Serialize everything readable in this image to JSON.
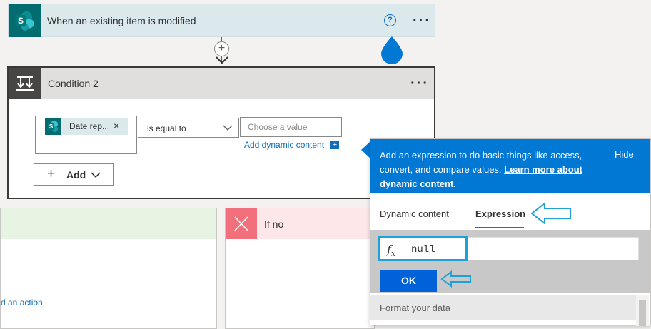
{
  "trigger": {
    "title": "When an existing item is modified",
    "help_label": "?",
    "more_label": "···"
  },
  "connector": {
    "plus_label": "+"
  },
  "condition": {
    "title": "Condition 2",
    "more_label": "···",
    "token_label": "Date rep...",
    "token_remove": "×",
    "operator": "is equal to",
    "value_placeholder": "Choose a value",
    "add_dynamic_label": "Add dynamic content",
    "add_dynamic_plus": "+",
    "add_button": {
      "plus": "+",
      "label": "Add"
    }
  },
  "branches": {
    "yes_add_action": "d an action",
    "no_label": "If no"
  },
  "popup": {
    "info_text": "Add an expression to do basic things like access, convert, and compare values.",
    "learn_more": "Learn more about dynamic content.",
    "hide_label": "Hide",
    "tabs": [
      {
        "label": "Dynamic content",
        "active": false
      },
      {
        "label": "Expression",
        "active": true
      }
    ],
    "expression_value": "null",
    "ok_label": "OK",
    "format_label": "Format your data"
  },
  "colors": {
    "accent": "#0078d4",
    "sharepoint": "#036c70",
    "annotation": "#1ea0d8"
  },
  "icons": [
    "sharepoint-icon",
    "help-icon",
    "more-icon",
    "add-step-icon",
    "condition-icon",
    "chevron-down-icon",
    "close-icon",
    "fx-icon",
    "annotation-arrow-icon"
  ]
}
